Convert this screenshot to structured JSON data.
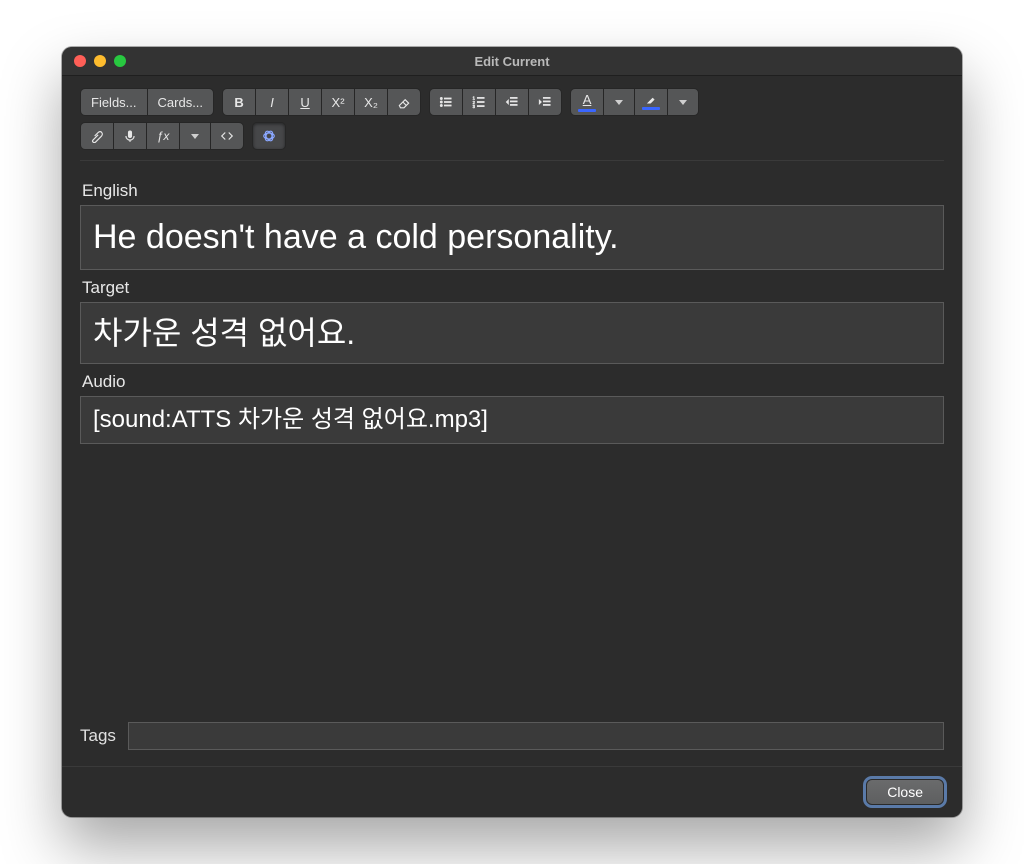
{
  "window": {
    "title": "Edit Current"
  },
  "toolbar": {
    "fields_label": "Fields...",
    "cards_label": "Cards...",
    "bold_label": "B",
    "italic_label": "I",
    "underline_label": "U",
    "superscript_label": "X²",
    "subscript_label": "X₂",
    "text_color_letter": "A",
    "fx_label": "ƒx"
  },
  "fields": {
    "english": {
      "label": "English",
      "value": "He doesn't have a cold personality."
    },
    "target": {
      "label": "Target",
      "value": "차가운 성격 없어요."
    },
    "audio": {
      "label": "Audio",
      "value": "[sound:ATTS 차가운 성격 없어요.mp3]"
    }
  },
  "tags": {
    "label": "Tags",
    "value": ""
  },
  "footer": {
    "close_label": "Close"
  }
}
